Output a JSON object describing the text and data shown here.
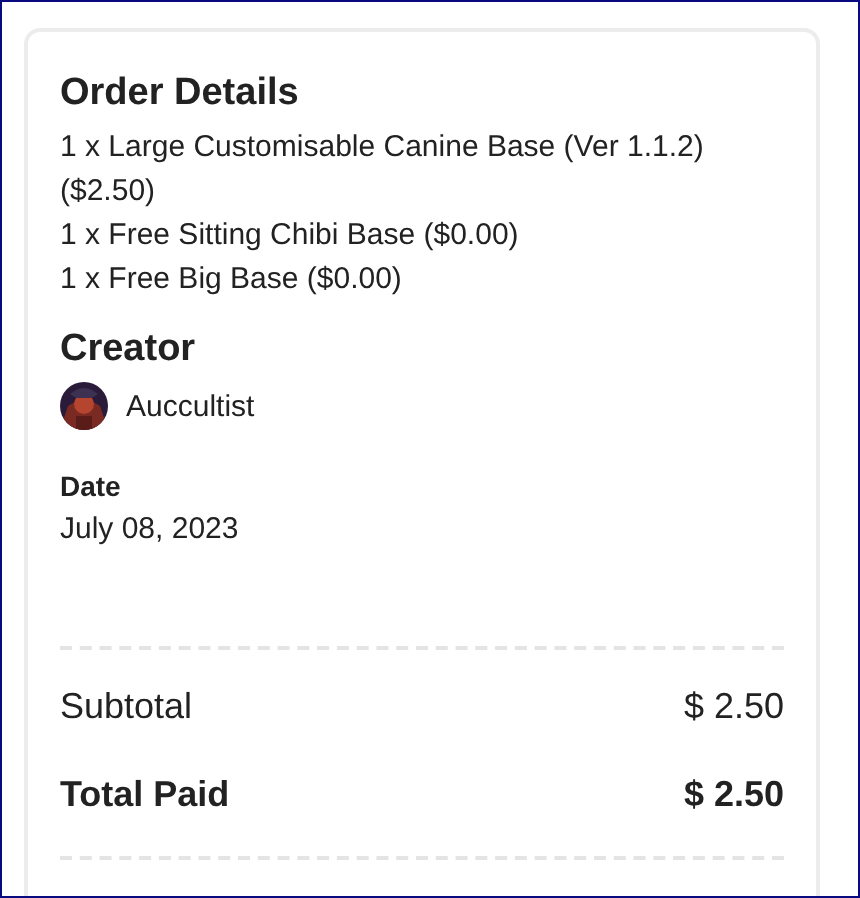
{
  "order_details": {
    "title": "Order Details",
    "items": [
      "1 x Large Customisable Canine Base (Ver 1.1.2) ($2.50)",
      "1 x Free Sitting Chibi Base ($0.00)",
      "1 x Free Big Base ($0.00)"
    ]
  },
  "creator": {
    "title": "Creator",
    "name": "Auccultist"
  },
  "date": {
    "label": "Date",
    "value": "July 08, 2023"
  },
  "totals": [
    {
      "label": "Subtotal",
      "value": "$ 2.50",
      "kind": "regular"
    },
    {
      "label": "Total Paid",
      "value": "$ 2.50",
      "kind": "total"
    }
  ]
}
